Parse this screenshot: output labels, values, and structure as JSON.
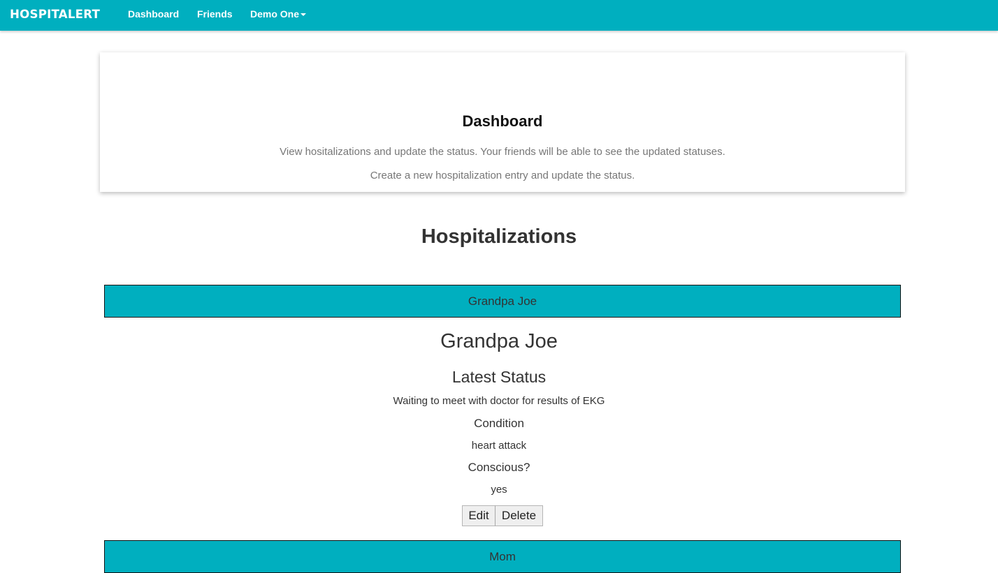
{
  "navbar": {
    "brand": "HospitAlert",
    "links": [
      "Dashboard",
      "Friends"
    ],
    "user_menu": "Demo One",
    "accent": "#00afbf"
  },
  "hero": {
    "title": "Dashboard",
    "lines": [
      "View hositalizations and update the status. Your friends will be able to see the updated statuses.",
      "Create a new hospitalization entry and update the status."
    ]
  },
  "section_title": "Hospitalizations",
  "hospitalizations": [
    {
      "name": "Grandpa Joe"
    },
    {
      "name": "Mom"
    }
  ],
  "details": {
    "name": "Grandpa Joe",
    "status_heading": "Latest Status",
    "status_value": "Waiting to meet with doctor for results of EKG",
    "condition_heading": "Condition",
    "condition_value": "heart attack",
    "conscious_heading": "Conscious?",
    "conscious_value": "yes"
  },
  "actions": {
    "edit_label": "Edit",
    "delete_label": "Delete"
  }
}
